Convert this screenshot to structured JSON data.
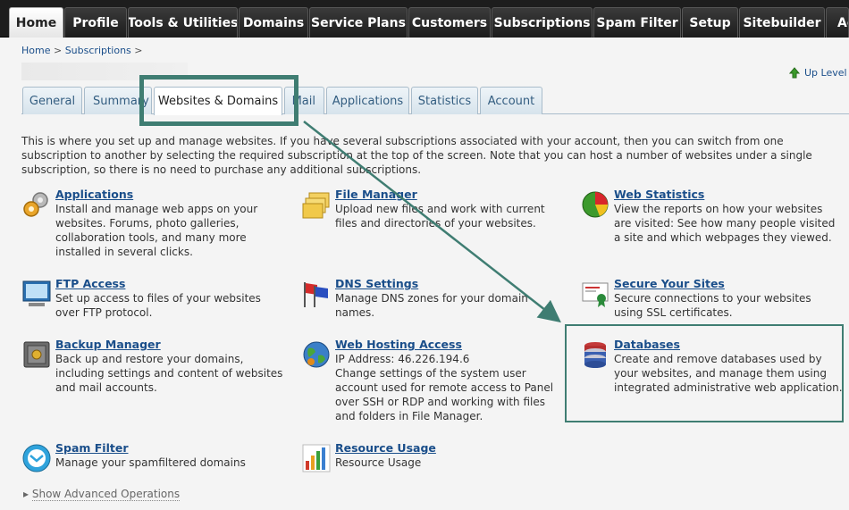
{
  "nav": {
    "tabs": [
      {
        "label": "Home"
      },
      {
        "label": "Profile"
      },
      {
        "label": "Tools & Utilities"
      },
      {
        "label": "Domains"
      },
      {
        "label": "Service Plans"
      },
      {
        "label": "Customers"
      },
      {
        "label": "Subscriptions"
      },
      {
        "label": "Spam Filter"
      },
      {
        "label": "Setup"
      },
      {
        "label": "Sitebuilder"
      },
      {
        "label": "Ac"
      }
    ]
  },
  "breadcrumb": {
    "home": "Home",
    "sep1": ">",
    "subscriptions": "Subscriptions",
    "sep2": ">"
  },
  "up_level": "Up Level",
  "subtabs": [
    {
      "label": "General"
    },
    {
      "label": "Summary"
    },
    {
      "label": "Websites & Domains"
    },
    {
      "label": "Mail"
    },
    {
      "label": "Applications"
    },
    {
      "label": "Statistics"
    },
    {
      "label": "Account"
    }
  ],
  "intro": "This is where you set up and manage websites. If you have several subscriptions associated with your account, then you can switch from one subscription to another by selecting the required subscription at the top of the screen. Note that you can host a number of websites under a single subscription, so there is no need to purchase any additional subscriptions.",
  "items": {
    "applications": {
      "title": "Applications",
      "lines": [
        "Install and manage web apps on your",
        "websites. Forums, photo galleries,",
        "collaboration tools, and many more",
        "installed in several clicks."
      ]
    },
    "file_manager": {
      "title": "File Manager",
      "lines": [
        "Upload new files and work with current",
        "files and directories of your websites."
      ]
    },
    "web_statistics": {
      "title": "Web Statistics",
      "lines": [
        "View the reports on how your websites",
        "are visited: See how many people visited",
        "a site and which webpages they viewed."
      ]
    },
    "ftp_access": {
      "title": "FTP Access",
      "lines": [
        "Set up access to files of your websites",
        "over FTP protocol."
      ]
    },
    "dns_settings": {
      "title": "DNS Settings",
      "lines": [
        "Manage DNS zones for your domain",
        "names."
      ]
    },
    "secure_sites": {
      "title": "Secure Your Sites",
      "lines": [
        "Secure connections to your websites",
        "using SSL certificates."
      ]
    },
    "backup_manager": {
      "title": "Backup Manager",
      "lines": [
        "Back up and restore your domains,",
        "including settings and content of websites",
        "and mail accounts."
      ]
    },
    "web_hosting": {
      "title": "Web Hosting Access",
      "lines": [
        "IP Address: 46.226.194.6",
        "Change settings of the system user",
        "account used for remote access to Panel",
        "over SSH or RDP and working with files",
        "and folders in File Manager."
      ]
    },
    "databases": {
      "title": "Databases",
      "lines": [
        "Create and remove databases used by",
        "your websites, and manage them using",
        "integrated administrative web application."
      ]
    },
    "spam_filter": {
      "title": "Spam Filter",
      "lines": [
        "Manage your spamfiltered domains"
      ]
    },
    "resource_usage": {
      "title": "Resource Usage",
      "lines": [
        "Resource Usage"
      ]
    }
  },
  "advanced": {
    "arrow": "▸",
    "label": "Show Advanced Operations"
  },
  "colors": {
    "highlight": "#3f7d72",
    "link": "#1a4e8a",
    "nav_bg": "#1d1d1d"
  }
}
